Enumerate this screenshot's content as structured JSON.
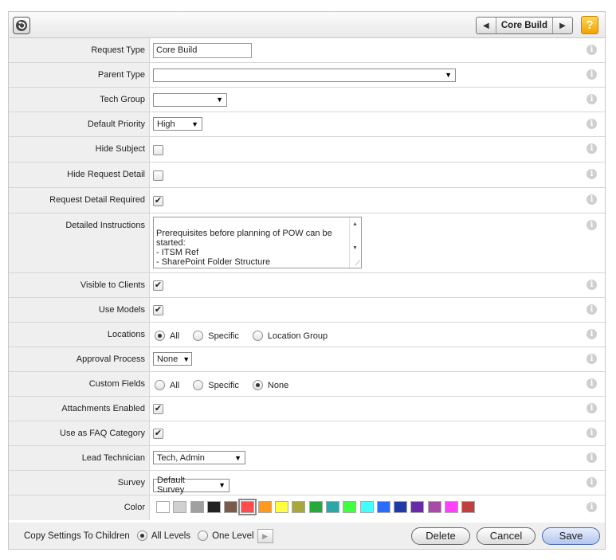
{
  "toolbar": {
    "nav_label": "Core Build",
    "help_label": "?"
  },
  "fields": {
    "request_type": {
      "label": "Request Type",
      "value": "Core Build"
    },
    "parent_type": {
      "label": "Parent Type",
      "value": ""
    },
    "tech_group": {
      "label": "Tech Group",
      "value": ""
    },
    "default_priority": {
      "label": "Default Priority",
      "value": "High"
    },
    "hide_subject": {
      "label": "Hide Subject",
      "checked": false
    },
    "hide_request_detail": {
      "label": "Hide Request Detail",
      "checked": false
    },
    "request_detail_required": {
      "label": "Request Detail Required",
      "checked": true
    },
    "detailed_instructions": {
      "label": "Detailed Instructions",
      "value": "Prerequisites before planning of POW can be started:\n- ITSM Ref\n- SharePoint Folder Structure\n- WBS"
    },
    "visible_to_clients": {
      "label": "Visible to Clients",
      "checked": true
    },
    "use_models": {
      "label": "Use Models",
      "checked": true
    },
    "locations": {
      "label": "Locations",
      "options": [
        "All",
        "Specific",
        "Location Group"
      ],
      "selected": "All"
    },
    "approval_process": {
      "label": "Approval Process",
      "value": "None"
    },
    "custom_fields": {
      "label": "Custom Fields",
      "options": [
        "All",
        "Specific",
        "None"
      ],
      "selected": "None"
    },
    "attachments_enabled": {
      "label": "Attachments Enabled",
      "checked": true
    },
    "use_as_faq_category": {
      "label": "Use as FAQ Category",
      "checked": true
    },
    "lead_technician": {
      "label": "Lead Technician",
      "value": "Tech, Admin"
    },
    "survey": {
      "label": "Survey",
      "value": "Default Survey"
    },
    "color": {
      "label": "Color",
      "selected": "#ff4d4d",
      "swatches": [
        "#ffffff",
        "#d0d0d0",
        "#a0a0a0",
        "#222222",
        "#7a5a4a",
        "#ff4d4d",
        "#ff9a1e",
        "#ffff40",
        "#a8a83a",
        "#27a83a",
        "#2aa8a8",
        "#40ff40",
        "#40ffff",
        "#2a6bff",
        "#1f3aa8",
        "#6a2aa8",
        "#a84aa8",
        "#ff40ff",
        "#c04040"
      ]
    }
  },
  "footer": {
    "copy_label": "Copy Settings To Children",
    "all_levels": "All Levels",
    "one_level": "One Level",
    "delete": "Delete",
    "cancel": "Cancel",
    "save": "Save"
  },
  "info_icon": "i"
}
